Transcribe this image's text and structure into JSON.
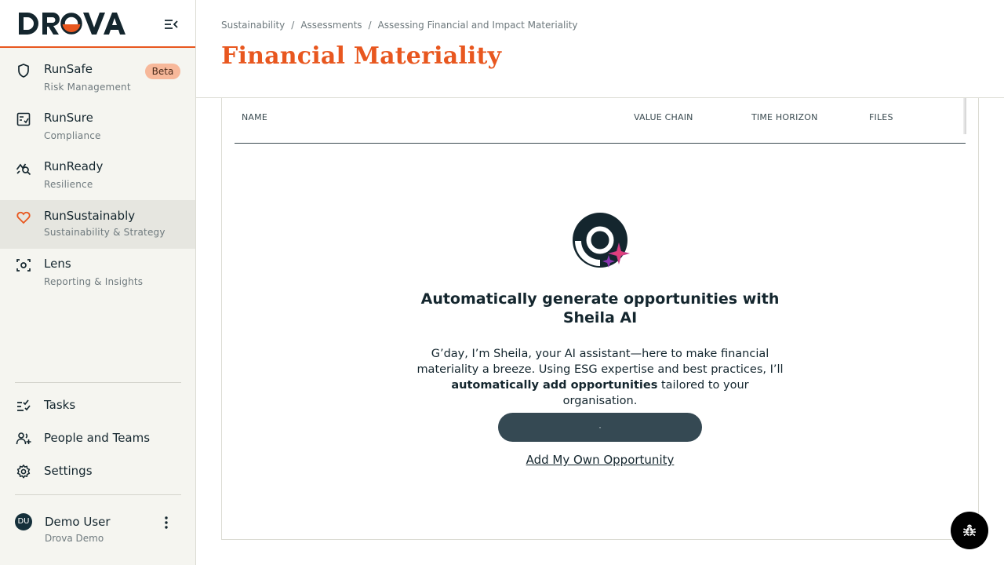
{
  "brand": {
    "name": "DROVA",
    "accent": "#e8571f",
    "dark": "#14262e"
  },
  "sidebar": {
    "modules": [
      {
        "title": "RunSafe",
        "subtitle": "Risk Management",
        "badge": "Beta",
        "icon": "shield-icon"
      },
      {
        "title": "RunSure",
        "subtitle": "Compliance",
        "icon": "checklist-icon"
      },
      {
        "title": "RunReady",
        "subtitle": "Resilience",
        "icon": "chart-search-icon"
      },
      {
        "title": "RunSustainably",
        "subtitle": "Sustainability & Strategy",
        "icon": "heart-icon",
        "active": true
      },
      {
        "title": "Lens",
        "subtitle": "Reporting & Insights",
        "icon": "scan-icon"
      }
    ],
    "utilities": [
      {
        "label": "Tasks",
        "icon": "tasks-icon"
      },
      {
        "label": "People and Teams",
        "icon": "people-add-icon"
      },
      {
        "label": "Settings",
        "icon": "gear-icon"
      }
    ],
    "user": {
      "initials": "DU",
      "name": "Demo User",
      "org": "Drova Demo"
    }
  },
  "header": {
    "breadcrumb": [
      "Sustainability",
      "Assessments",
      "Assessing Financial and Impact Materiality"
    ],
    "title": "Financial Materiality"
  },
  "table": {
    "columns": [
      "NAME",
      "VALUE CHAIN",
      "TIME HORIZON",
      "FILES"
    ]
  },
  "empty_state": {
    "title": "Automatically generate opportunities with Sheila AI",
    "desc_prefix": "G’day, I’m Sheila, your AI assistant—here to make financial materiality a breeze. Using ESG expertise and best practices, I’ll ",
    "desc_bold": "automatically add opportunities",
    "desc_suffix": " tailored to your organisation.",
    "generate_label": "·",
    "add_own_label": "Add My Own Opportunity"
  },
  "fab": {
    "icon": "bug-icon"
  }
}
